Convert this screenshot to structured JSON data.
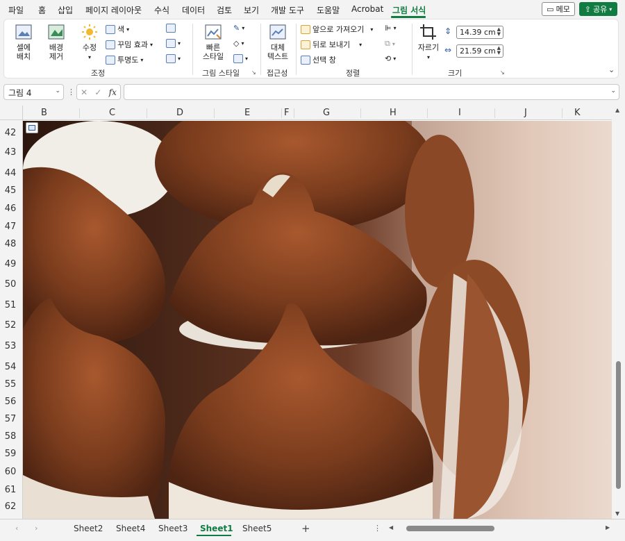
{
  "menu": {
    "tabs": [
      "파일",
      "홈",
      "삽입",
      "페이지 레이아웃",
      "수식",
      "데이터",
      "검토",
      "보기",
      "개발 도구",
      "도움말",
      "Acrobat",
      "그림 서식"
    ],
    "memo_label": "메모",
    "share_label": "공유"
  },
  "ribbon": {
    "remove_bg": "배경\n제거",
    "cell_place": "셀에\n배치",
    "corrections": "수정",
    "color": "색",
    "artistic": "꾸밈 효과",
    "transparency": "투명도",
    "adjust_group": "조정",
    "quick_styles": "빠른\n스타일",
    "picture_styles_group": "그림 스타일",
    "alt_text": "대체\n텍스트",
    "accessibility_group": "접근성",
    "bring_forward": "앞으로 가져오기",
    "send_backward": "뒤로 보내기",
    "selection_pane": "선택 창",
    "arrange_group": "정렬",
    "crop": "자르기",
    "height": "14.39 cm",
    "width": "21.59 cm",
    "size_group": "크기"
  },
  "formula": {
    "namebox": "그림 4",
    "cancel": "✕",
    "enter": "✓",
    "fx": "fx",
    "value": ""
  },
  "columns": [
    "B",
    "C",
    "D",
    "E",
    "F",
    "G",
    "H",
    "I",
    "J",
    "K"
  ],
  "rows": [
    "42",
    "43",
    "44",
    "45",
    "46",
    "47",
    "48",
    "49",
    "50",
    "51",
    "52",
    "53",
    "54",
    "55",
    "56",
    "57",
    "58",
    "59",
    "60",
    "61",
    "62"
  ],
  "picture": {
    "alt": "코코아 파우더를 뿌린 머랭 쿠키 사진"
  },
  "sheets": [
    "Sheet2",
    "Sheet4",
    "Sheet3",
    "Sheet1",
    "Sheet5"
  ],
  "active_sheet": "Sheet1",
  "colors": {
    "accent": "#107c41"
  }
}
